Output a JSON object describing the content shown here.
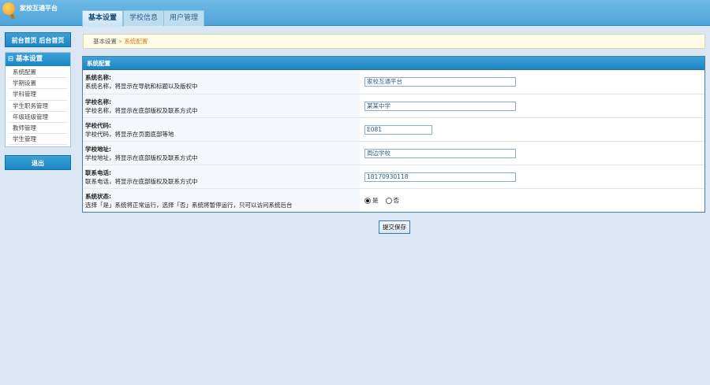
{
  "app_title": "家校互通平台",
  "tabs": [
    "基本设置",
    "学校信息",
    "用户管理"
  ],
  "sidebar": {
    "nav_label": "前台首页 后台首页",
    "menu_title": "基本设置",
    "items": [
      "系统配置",
      "学期设置",
      "学科管理",
      "学生职务管理",
      "年级班级管理",
      "教师管理",
      "学生管理"
    ],
    "exit_label": "退出"
  },
  "breadcrumb": {
    "parent": "基本设置",
    "sep": " » ",
    "current": "系统配置"
  },
  "panel": {
    "title": "系统配置",
    "fields": [
      {
        "label": "系统名称:",
        "desc": "系统名称，将显示在导航和标题以及版权中",
        "value": "家校互通平台"
      },
      {
        "label": "学校名称:",
        "desc": "学校名称，将显示在底部版权及联系方式中",
        "value": "某某中学"
      },
      {
        "label": "学校代码:",
        "desc": "学校代码，将显示在页面底部等地",
        "value": "E081"
      },
      {
        "label": "学校地址:",
        "desc": "学校地址，将显示在底部版权及联系方式中",
        "value": "周边学校"
      },
      {
        "label": "联系电话:",
        "desc": "联系电话，将显示在底部版权及联系方式中",
        "value": "18170930118"
      }
    ],
    "status": {
      "label": "系统状态:",
      "desc": "选择「是」系统将正常运行，选择「否」系统将暂停运行，只可以访问系统后台",
      "options": [
        "是",
        "否"
      ],
      "selected": "是"
    }
  },
  "submit_label": "提交保存"
}
